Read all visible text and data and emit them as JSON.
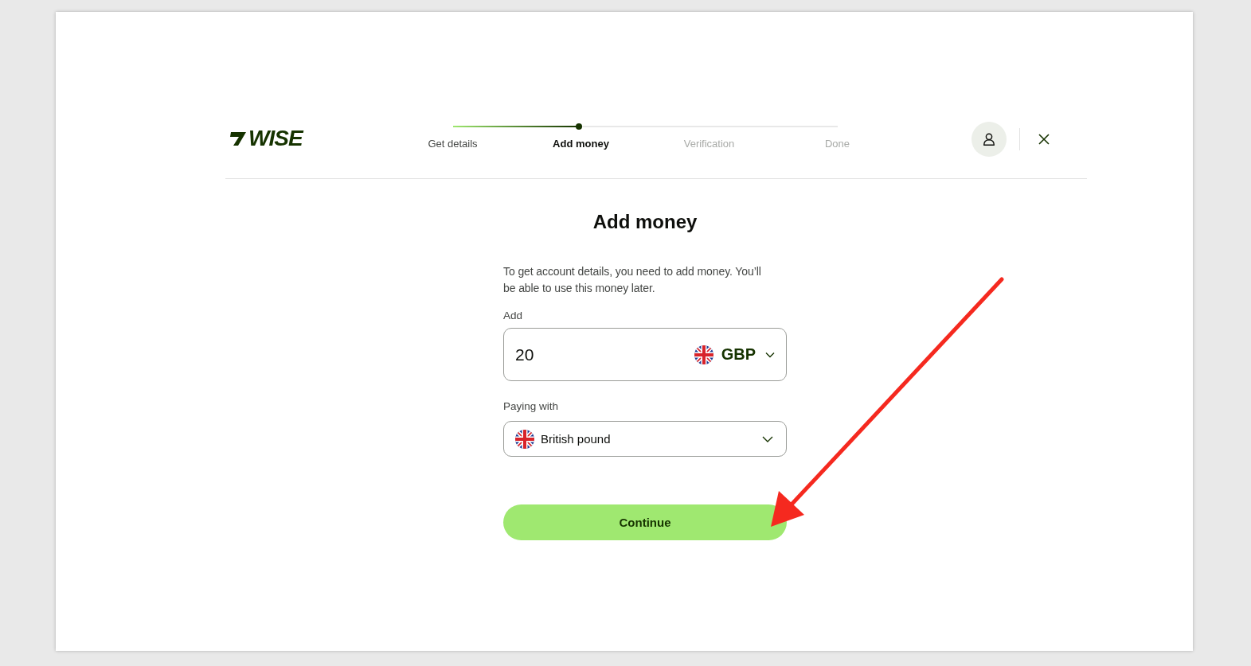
{
  "header": {
    "logo": "WISE",
    "progress": {
      "level": 0.33
    },
    "steps": [
      {
        "label": "Get details",
        "completed": true,
        "selected": false
      },
      {
        "label": "Add money",
        "completed": false,
        "selected": true
      },
      {
        "label": "Verification",
        "completed": false,
        "selected": false
      },
      {
        "label": "Done",
        "completed": false,
        "selected": false
      }
    ]
  },
  "title": "Add money",
  "description": "To get account details, you need to add money. You’ll be able to use this money later.",
  "amount": {
    "label": "Add",
    "value": "20",
    "currency": "GBP"
  },
  "paying_with": {
    "label": "Paying with",
    "value": "British pound"
  },
  "continue_button": "Continue"
}
